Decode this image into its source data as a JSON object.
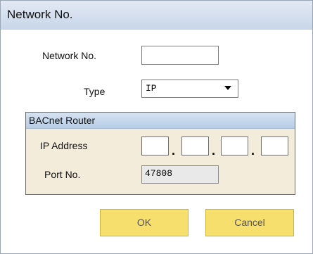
{
  "dialog": {
    "title": "Network No."
  },
  "form": {
    "network_no_label": "Network No.",
    "network_no_value": "",
    "type_label": "Type",
    "type_value": "IP"
  },
  "bacnet_router": {
    "group_title": "BACnet Router",
    "ip_address_label": "IP Address",
    "ip_octets": [
      "",
      "",
      "",
      ""
    ],
    "port_label": "Port No.",
    "port_value": "47808"
  },
  "buttons": {
    "ok_label": "OK",
    "cancel_label": "Cancel"
  },
  "colors": {
    "button_fill": "#f7df6d",
    "group_fill": "#f4ecdb",
    "title_bar": "#c9d7ea"
  }
}
